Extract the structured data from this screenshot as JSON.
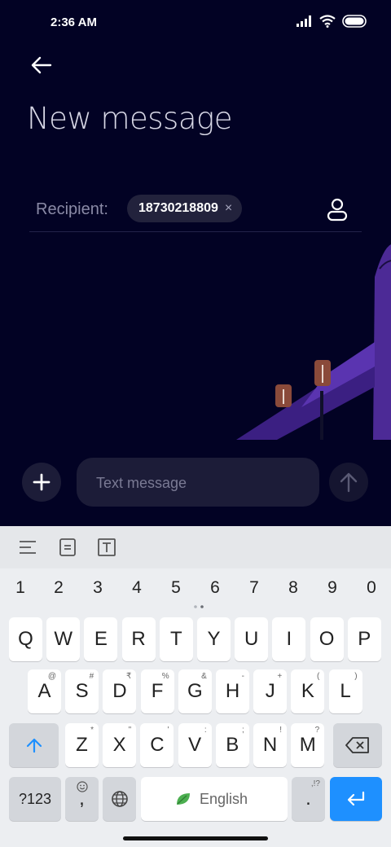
{
  "status_bar": {
    "time": "2:36 AM",
    "battery": "full"
  },
  "header": {
    "title": "New message"
  },
  "recipient": {
    "label": "Recipient:",
    "chip": "18730218809",
    "remove_glyph": "×"
  },
  "composer": {
    "placeholder": "Text message"
  },
  "keyboard": {
    "numbers": [
      "1",
      "2",
      "3",
      "4",
      "5",
      "6",
      "7",
      "8",
      "9",
      "0"
    ],
    "row1": [
      "Q",
      "W",
      "E",
      "R",
      "T",
      "Y",
      "U",
      "I",
      "O",
      "P"
    ],
    "row2": [
      [
        "A",
        "@"
      ],
      [
        "S",
        "#"
      ],
      [
        "D",
        "₹"
      ],
      [
        "F",
        "%"
      ],
      [
        "G",
        "&"
      ],
      [
        "H",
        "-"
      ],
      [
        "J",
        "+"
      ],
      [
        "K",
        "("
      ],
      [
        "L",
        ")"
      ]
    ],
    "row3": [
      [
        "Z",
        "*"
      ],
      [
        "X",
        "\""
      ],
      [
        "C",
        "'"
      ],
      [
        "V",
        ":"
      ],
      [
        "B",
        ";"
      ],
      [
        "N",
        "!"
      ],
      [
        "M",
        "?"
      ]
    ],
    "symbols_key": "?123",
    "comma_key": ",",
    "space_label": "English",
    "period_key": ".",
    "period_hint": ",!?"
  },
  "colors": {
    "background": "#020224",
    "accent": "#1e90ff",
    "plane": "#4c2a96"
  }
}
